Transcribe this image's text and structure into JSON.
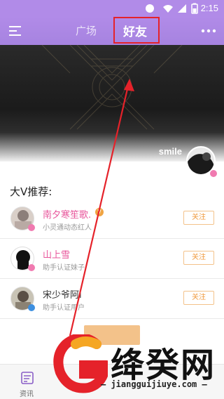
{
  "status_bar": {
    "time": "2:15",
    "icons": [
      "circle-status-icon",
      "wifi-icon",
      "signal-icon",
      "battery-icon"
    ]
  },
  "header": {
    "tabs": [
      {
        "label": "广场",
        "active": false
      },
      {
        "label": "好友",
        "active": true
      }
    ],
    "accent_color": "#b18be8",
    "highlight_color": "#e5222a"
  },
  "banner": {
    "username": "smile"
  },
  "recommend": {
    "title": "大V推荐:",
    "follow_label": "关注",
    "items": [
      {
        "name": "南夕寒笙歌.",
        "desc": "小灵通动态红人",
        "name_color": "#e8559b",
        "badge": "V"
      },
      {
        "name": "山上雪",
        "desc": "助手认证妹子",
        "name_color": "#e8559b",
        "badge": ""
      },
      {
        "name": "宋少爷阿i",
        "desc": "助手认证用户",
        "name_color": "#333333",
        "badge": ""
      }
    ]
  },
  "bottom_nav": {
    "news_label": "资讯"
  },
  "watermark": {
    "brand": "绛癸网",
    "url": "— jiangguijiuye.com —"
  }
}
